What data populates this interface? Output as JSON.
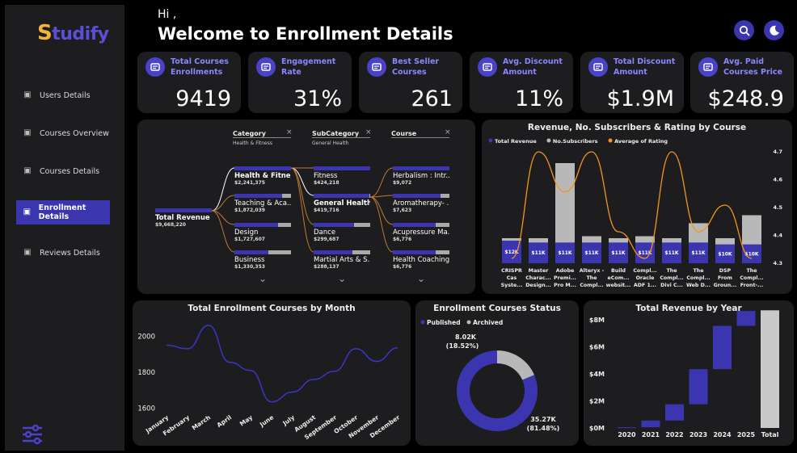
{
  "app": {
    "logo_first": "S",
    "logo_rest": "tudify"
  },
  "header": {
    "greeting": "Hi ,",
    "title": "Welcome to  Enrollment Details"
  },
  "sidebar": {
    "items": [
      {
        "label": "Users Details",
        "icon": "users-icon"
      },
      {
        "label": "Courses Overview",
        "icon": "courses-overview-icon"
      },
      {
        "label": "Courses Details",
        "icon": "courses-details-icon"
      },
      {
        "label": "Enrollment Details",
        "icon": "enrollment-icon",
        "active": true
      },
      {
        "label": "Reviews Details",
        "icon": "reviews-icon"
      }
    ]
  },
  "kpis": [
    {
      "label1": "Total Courses",
      "label2": "Enrollments",
      "value": "9419",
      "icon": "enrollments-icon"
    },
    {
      "label1": "Engagement Rate",
      "label2": "",
      "value": "31%",
      "icon": "engagement-icon"
    },
    {
      "label1": "Best Seller",
      "label2": "Courses",
      "value": "261",
      "icon": "best-seller-icon"
    },
    {
      "label1": "Avg. Discount",
      "label2": "Amount",
      "value": "11%",
      "icon": "discount-icon"
    },
    {
      "label1": "Total Discount",
      "label2": "Amount",
      "value": "$1.9M",
      "icon": "total-discount-icon"
    },
    {
      "label1": "Avg. Paid",
      "label2": "Courses Price",
      "value": "$248.9",
      "icon": "price-icon"
    }
  ],
  "tree": {
    "headers": [
      {
        "label": "Category",
        "filter": "Health & Fitness"
      },
      {
        "label": "SubCategory",
        "filter": "General Health"
      },
      {
        "label": "Course",
        "filter": ""
      }
    ],
    "root": {
      "label": "Total Revenue",
      "value": "$9,668,220"
    },
    "level1": [
      {
        "label": "Health & Fitness",
        "value": "$2,241,375",
        "fill": 1.0,
        "bold": true
      },
      {
        "label": "Teaching & Aca...",
        "value": "$1,872,039",
        "fill": 0.84,
        "bold": false
      },
      {
        "label": "Design",
        "value": "$1,727,607",
        "fill": 0.77,
        "bold": false
      },
      {
        "label": "Business",
        "value": "$1,330,353",
        "fill": 0.6,
        "bold": false
      }
    ],
    "level2": [
      {
        "label": "Fitness",
        "value": "$424,218",
        "fill": 1.0,
        "bold": false
      },
      {
        "label": "General Health",
        "value": "$419,716",
        "fill": 0.99,
        "bold": true
      },
      {
        "label": "Dance",
        "value": "$299,687",
        "fill": 0.71,
        "bold": false
      },
      {
        "label": "Martial Arts & S...",
        "value": "$288,137",
        "fill": 0.68,
        "bold": false
      }
    ],
    "level3": [
      {
        "label": "Herbalism : Intr...",
        "value": "$9,072",
        "fill": 1.0
      },
      {
        "label": "Aromatherapy- ...",
        "value": "$7,623",
        "fill": 0.84
      },
      {
        "label": "Acupressure Ma...",
        "value": "$6,776",
        "fill": 0.75
      },
      {
        "label": "Health Coaching...",
        "value": "$6,776",
        "fill": 0.75
      }
    ]
  },
  "chart_data": [
    {
      "type": "bar",
      "title": "Revenue, No. Subscribers & Rating by Course",
      "legend": [
        "Total Revenue",
        "No.Subscribers",
        "Average of Rating"
      ],
      "legend_colors": [
        "#3b35b0",
        "#b8b8b8",
        "#f7931e"
      ],
      "categories": [
        [
          "CRISPR",
          "Cas",
          "Syste..."
        ],
        [
          "Master",
          "Charac...",
          "Design..."
        ],
        [
          "Adobe",
          "Premi...",
          "Pro M..."
        ],
        [
          "Alteryx -",
          "The",
          "Compl..."
        ],
        [
          "Build",
          "eCom...",
          "websit..."
        ],
        [
          "Compl...",
          "Oracle",
          "ADF 1..."
        ],
        [
          "The",
          "Compl...",
          "Divi C..."
        ],
        [
          "The",
          "Compl...",
          "Web D..."
        ],
        [
          "DSP",
          "From",
          "Groun..."
        ],
        [
          "The",
          "Compl...",
          "Front-..."
        ]
      ],
      "revenue_labels": [
        "$12K",
        "$11K",
        "$11K",
        "$11K",
        "$11K",
        "$11K",
        "$11K",
        "$11K",
        "$10K",
        "$10K"
      ],
      "revenue": [
        12,
        11,
        11,
        11,
        11,
        11,
        11,
        11,
        10,
        10
      ],
      "subscribers": [
        0.25,
        0.25,
        1.0,
        0.27,
        0.25,
        0.27,
        0.25,
        0.4,
        0.25,
        0.48
      ],
      "rating": [
        4.3,
        4.7,
        4.55,
        4.7,
        4.4,
        4.3,
        4.7,
        4.4,
        4.5,
        4.3
      ],
      "rating_ticks": [
        "4.7",
        "4.6",
        "4.5",
        "4.4",
        "4.3"
      ],
      "rating_ylim": [
        4.3,
        4.7
      ]
    },
    {
      "type": "line",
      "title": "Total Enrollment Courses by Month",
      "categories": [
        "January",
        "February",
        "March",
        "April",
        "May",
        "June",
        "July",
        "August",
        "September",
        "October",
        "November",
        "December"
      ],
      "values": [
        1950,
        1930,
        2060,
        1855,
        1810,
        1635,
        1690,
        1760,
        1805,
        1930,
        1860,
        1935
      ],
      "yticks": [
        "2000",
        "1800",
        "1600"
      ],
      "ylim": [
        1580,
        2100
      ]
    },
    {
      "type": "pie",
      "title": "Enrollment Courses Status",
      "legend": [
        "Published",
        "Archived"
      ],
      "colors": [
        "#3b35b0",
        "#b8b8b8"
      ],
      "values": [
        35270,
        8020
      ],
      "labels": [
        "35.27K",
        "8.02K"
      ],
      "percents": [
        "(81.48%)",
        "(18.52%)"
      ]
    },
    {
      "type": "bar",
      "title": "Total Revenue by Year",
      "categories": [
        "2020",
        "2021",
        "2022",
        "2023",
        "2024",
        "2025",
        "Total"
      ],
      "values": [
        0.05,
        0.5,
        1.2,
        2.6,
        3.2,
        1.1,
        8.7
      ],
      "yticks": [
        "$8M",
        "$6M",
        "$4M",
        "$2M",
        "$0M"
      ],
      "ylim": [
        0,
        8
      ],
      "colors": {
        "increase": "#3b35b0",
        "total": "#c8c8c8"
      }
    }
  ]
}
